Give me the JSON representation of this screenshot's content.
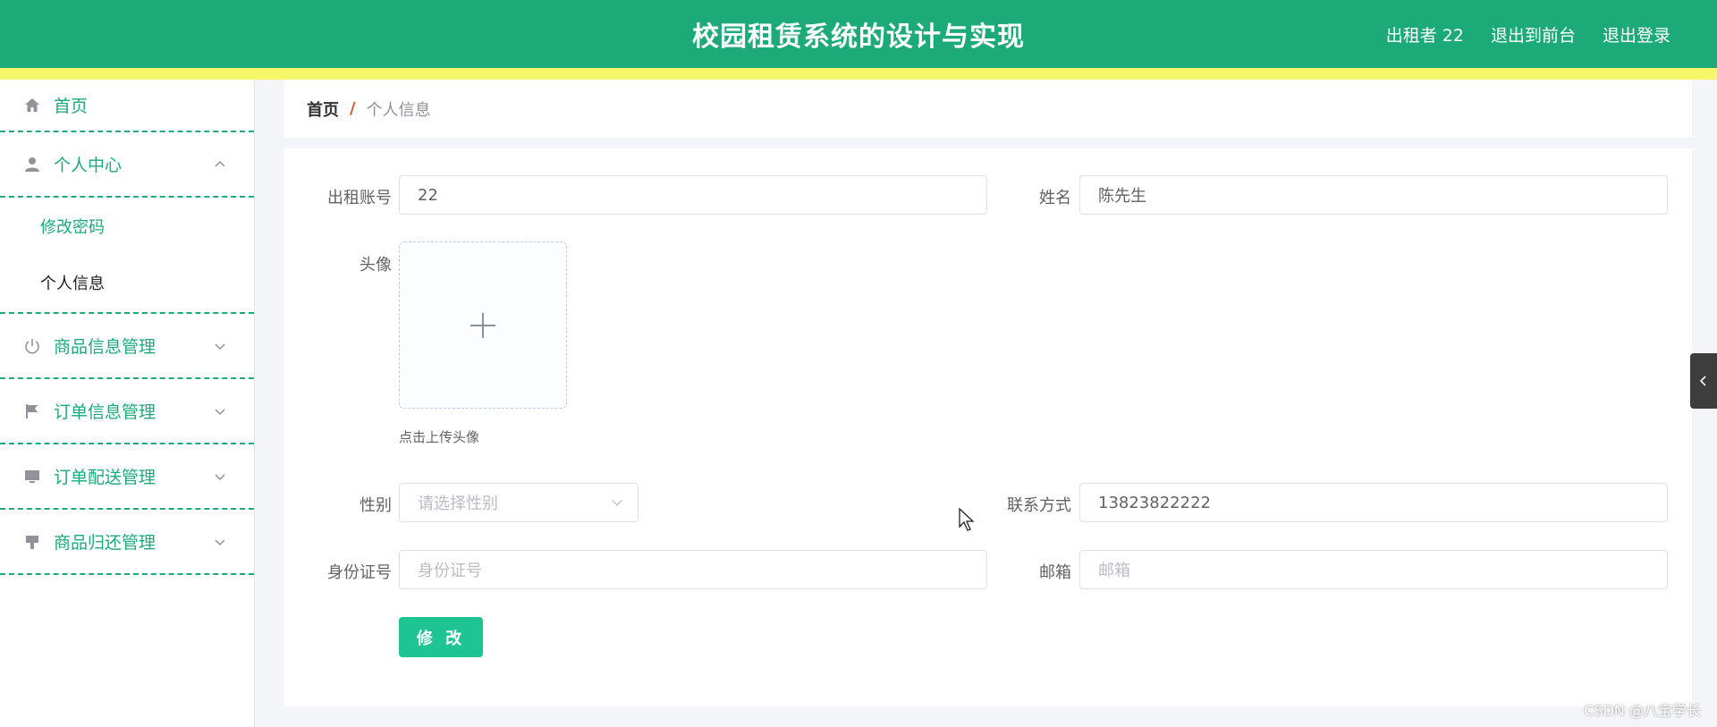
{
  "header": {
    "title": "校园租赁系统的设计与实现",
    "user": "出租者 22",
    "front": "退出到前台",
    "logout": "退出登录"
  },
  "sidebar": {
    "home": "首页",
    "personal_center": "个人中心",
    "change_password": "修改密码",
    "personal_info": "个人信息",
    "goods_mgmt": "商品信息管理",
    "order_mgmt": "订单信息管理",
    "delivery_mgmt": "订单配送管理",
    "return_mgmt": "商品归还管理"
  },
  "breadcrumb": {
    "home": "首页",
    "separator": "/",
    "current": "个人信息"
  },
  "form": {
    "account_label": "出租账号",
    "account_value": "22",
    "name_label": "姓名",
    "name_value": "陈先生",
    "avatar_label": "头像",
    "avatar_tip": "点击上传头像",
    "gender_label": "性别",
    "gender_placeholder": "请选择性别",
    "contact_label": "联系方式",
    "contact_value": "13823822222",
    "idcard_label": "身份证号",
    "idcard_placeholder": "身份证号",
    "email_label": "邮箱",
    "email_placeholder": "邮箱",
    "submit": "修 改"
  },
  "watermark": "CSDN @八宝学长",
  "colors": {
    "primary": "#1daa79",
    "accent_bar": "#f5f66a",
    "button": "#1ec593"
  }
}
